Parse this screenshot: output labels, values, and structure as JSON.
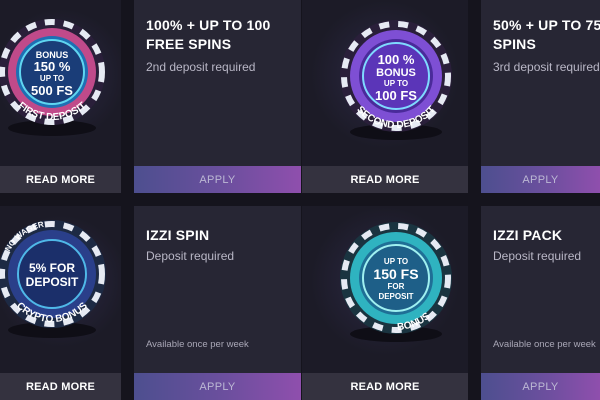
{
  "cards": [
    {
      "chip_lines": [
        "BONUS",
        "150 %",
        "UP TO",
        "500 FS"
      ],
      "chip_arc": "FIRST DEPOSIT",
      "read_more": "READ MORE",
      "title": "",
      "subtitle": "",
      "note": "",
      "apply": ""
    },
    {
      "chip_lines": [],
      "chip_arc": "",
      "read_more": "",
      "title": "100% + UP TO 100 FREE SPINS",
      "subtitle": "2nd deposit required",
      "note": "",
      "apply": "APPLY"
    }
  ],
  "row1": {
    "card_a": {
      "chip_lines": [
        "BONUS",
        "150 %",
        "UP TO",
        "500 FS"
      ],
      "chip_arc": "FIRST DEPOSIT",
      "read_more": "READ MORE"
    },
    "card_b": {
      "title": "100% + UP TO 100 FREE SPINS",
      "subtitle": "2nd deposit required",
      "apply": "APPLY"
    },
    "card_c": {
      "chip_lines": [
        "100 %",
        "BONUS",
        "UP TO",
        "100 FS"
      ],
      "chip_arc": "SECOND DEPOSIT",
      "read_more": "READ MORE"
    },
    "card_d": {
      "title": "50% + UP TO 75 SPINS",
      "subtitle": "3rd deposit required",
      "apply": "APPLY"
    }
  },
  "row2": {
    "card_a": {
      "chip_lines": [
        "5% FOR",
        "DEPOSIT"
      ],
      "chip_arc_top": "NO WAGER",
      "chip_arc": "CRYPTO BONUS",
      "read_more": "READ MORE"
    },
    "card_b": {
      "title": "IZZI SPIN",
      "subtitle": "Deposit required",
      "note": "Available once per week",
      "apply": "APPLY"
    },
    "card_c": {
      "chip_lines": [
        "UP TO",
        "150 FS",
        "FOR",
        "DEPOSIT"
      ],
      "chip_arc": "BONUS",
      "read_more": "READ MORE"
    },
    "card_d": {
      "title": "IZZI PACK",
      "subtitle": "Deposit required",
      "note": "Available once per week",
      "apply": "APPLY"
    }
  },
  "colors": {
    "chip_pink": "#e0508f",
    "chip_purple": "#8a4fd8",
    "chip_blue": "#3f7fd6",
    "chip_cyan": "#35c6c9",
    "apply_gradient_start": "#4d4f8f",
    "apply_gradient_end": "#8f4fad"
  }
}
